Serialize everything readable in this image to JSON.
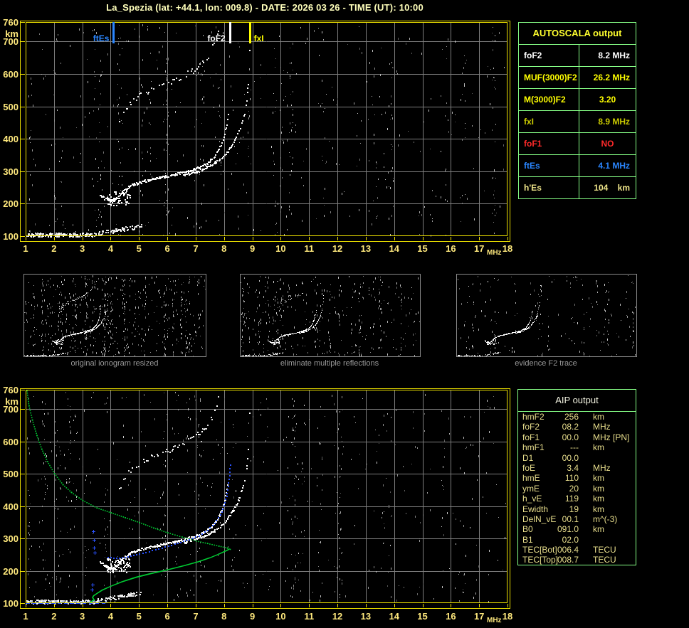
{
  "title": "La_Spezia (lat: +44.1, lon: 009.8) - DATE: 2026 03 26 - TIME (UT): 10:00",
  "colors": {
    "frame": "#eee200",
    "grid": "#7e7e7e",
    "tick_label": "#ffe97d",
    "table_border": "#86ff86",
    "profile_green": "#00cc33",
    "trace_blue": "#2a52ff",
    "echo_white": "#ffffff"
  },
  "autoscala": {
    "title": "AUTOSCALA output",
    "rows": [
      {
        "label": "foF2",
        "value": "8.2 MHz",
        "color": "#ffffff",
        "align": "r"
      },
      {
        "label": "MUF(3000)F2",
        "value": "26.2 MHz",
        "color": "#ffff00",
        "align": "r"
      },
      {
        "label": "M(3000)F2",
        "value": "3.20",
        "color": "#ffff00",
        "align": "c"
      },
      {
        "label": "fxI",
        "value": "8.9 MHz",
        "color": "#c9c900",
        "align": "r"
      },
      {
        "label": "foF1",
        "value": "NO",
        "color": "#ff2a2a",
        "align": "c"
      },
      {
        "label": "ftEs",
        "value": "4.1 MHz",
        "color": "#2a86ff",
        "align": "r"
      },
      {
        "label": "h'Es",
        "value": "104    km",
        "color": "#efe58a",
        "align": "r"
      }
    ]
  },
  "aip": {
    "title": "AIP output",
    "rows": [
      {
        "label": "hmF2",
        "value": "256",
        "unit": "km",
        "note": ""
      },
      {
        "label": "foF2",
        "value": "08.2",
        "unit": "MHz",
        "note": ""
      },
      {
        "label": "foF1",
        "value": "00.0",
        "unit": "MHz",
        "note": "[PN]"
      },
      {
        "label": "hmF1",
        "value": "---",
        "unit": "km",
        "note": ""
      },
      {
        "label": "D1",
        "value": "00.0",
        "unit": "",
        "note": ""
      },
      {
        "label": "foE",
        "value": "3.4",
        "unit": "MHz",
        "note": ""
      },
      {
        "label": "hmE",
        "value": "110",
        "unit": "km",
        "note": ""
      },
      {
        "label": "ymE",
        "value": "20",
        "unit": "km",
        "note": ""
      },
      {
        "label": "h_vE",
        "value": "119",
        "unit": "km",
        "note": ""
      },
      {
        "label": "Ewidth",
        "value": "19",
        "unit": "km",
        "note": ""
      },
      {
        "label": "DelN_vE",
        "value": "00.1",
        "unit": "m^(-3)",
        "note": ""
      },
      {
        "label": "B0",
        "value": "091.0",
        "unit": "km",
        "note": ""
      },
      {
        "label": "B1",
        "value": "02.0",
        "unit": "",
        "note": ""
      },
      {
        "label": "TEC[Bot]",
        "value": "006.4",
        "unit": "TECU",
        "note": ""
      },
      {
        "label": "TEC[Top]",
        "value": "008.7",
        "unit": "TECU",
        "note": ""
      }
    ]
  },
  "thumbnails": [
    {
      "caption": "original ionogram resized",
      "noise": 720,
      "hop": 1,
      "seed": 21
    },
    {
      "caption": "eliminate multiple reflections",
      "noise": 430,
      "hop": 0.35,
      "seed": 22
    },
    {
      "caption": "evidence F2 trace",
      "noise": 210,
      "hop": 0,
      "seed": 23
    }
  ],
  "chart_data": [
    {
      "type": "scatter",
      "title": "scaled ionogram",
      "xlabel": "MHz",
      "ylabel": "km",
      "xlim": [
        1,
        18
      ],
      "ylim": [
        100,
        760
      ],
      "xticks": [
        1,
        2,
        3,
        4,
        5,
        6,
        7,
        8,
        9,
        10,
        11,
        12,
        13,
        14,
        15,
        16,
        17,
        18
      ],
      "yticks": [
        760,
        700,
        600,
        500,
        400,
        300,
        200,
        100
      ],
      "grid": true,
      "markers": [
        {
          "label": "ftEs",
          "f": 4.1,
          "color": "#2a86ff"
        },
        {
          "label": "foF2",
          "f": 8.2,
          "color": "#ffffff"
        },
        {
          "label": "fxI",
          "f": 8.9,
          "color": "#ffff00"
        }
      ],
      "series": {
        "es_band": {
          "f_range": [
            1.0,
            5.1
          ],
          "h_range": [
            100,
            135
          ]
        },
        "f_blob": {
          "f_range": [
            3.85,
            4.7
          ],
          "h_range": [
            196,
            240
          ]
        },
        "o_trace": [
          [
            3.6,
            230
          ],
          [
            3.75,
            219
          ],
          [
            3.95,
            210
          ],
          [
            4.1,
            211
          ],
          [
            4.25,
            222
          ],
          [
            4.45,
            242
          ],
          [
            4.7,
            257
          ],
          [
            5.0,
            267
          ],
          [
            5.4,
            276
          ],
          [
            5.8,
            283
          ],
          [
            6.2,
            290
          ],
          [
            6.6,
            299
          ],
          [
            7.0,
            309
          ],
          [
            7.3,
            321
          ],
          [
            7.55,
            338
          ],
          [
            7.75,
            360
          ],
          [
            7.9,
            388
          ],
          [
            8.0,
            415
          ],
          [
            8.06,
            440
          ],
          [
            8.1,
            462
          ],
          [
            8.13,
            480
          ]
        ],
        "x_trace": [
          [
            6.55,
            288
          ],
          [
            6.9,
            297
          ],
          [
            7.25,
            308
          ],
          [
            7.55,
            320
          ],
          [
            7.85,
            338
          ],
          [
            8.05,
            356
          ],
          [
            8.25,
            380
          ],
          [
            8.4,
            403
          ],
          [
            8.55,
            432
          ],
          [
            8.65,
            460
          ],
          [
            8.73,
            492
          ],
          [
            8.79,
            528
          ],
          [
            8.83,
            566
          ],
          [
            8.86,
            610
          ],
          [
            8.88,
            655
          ],
          [
            8.89,
            700
          ],
          [
            8.895,
            735
          ]
        ],
        "second_hop": "2x o_trace, f 4.3-8.3"
      },
      "noise": {
        "seed": 7,
        "count": 680,
        "streaks": 32
      }
    },
    {
      "type": "scatter",
      "title": "ionogram with AIP fitted trace and electron density profile",
      "xlabel": "MHz",
      "ylabel": "km",
      "xlim": [
        1,
        18
      ],
      "ylim": [
        100,
        760
      ],
      "xticks": [
        1,
        2,
        3,
        4,
        5,
        6,
        7,
        8,
        9,
        10,
        11,
        12,
        13,
        14,
        15,
        16,
        17,
        18
      ],
      "yticks": [
        760,
        700,
        600,
        500,
        400,
        300,
        200,
        100
      ],
      "grid": true,
      "overlays": {
        "blue_es": [
          1.0,
          3.85,
          105
        ],
        "blue_trace": [
          [
            3.9,
            244
          ],
          [
            4.2,
            240
          ],
          [
            4.6,
            245
          ],
          [
            5.0,
            254
          ],
          [
            5.45,
            264
          ],
          [
            5.9,
            275
          ],
          [
            6.35,
            287
          ],
          [
            6.75,
            299
          ],
          [
            7.1,
            310
          ],
          [
            7.4,
            327
          ],
          [
            7.65,
            349
          ],
          [
            7.85,
            375
          ],
          [
            7.98,
            403
          ],
          [
            8.07,
            432
          ],
          [
            8.13,
            462
          ],
          [
            8.17,
            495
          ],
          [
            8.2,
            530
          ]
        ],
        "blue_cluster": [
          [
            3.38,
            322
          ],
          [
            3.4,
            295
          ],
          [
            3.42,
            272
          ],
          [
            3.44,
            256
          ],
          [
            3.35,
            158
          ],
          [
            3.33,
            142
          ]
        ],
        "green_bottomside": [
          [
            3.18,
            101
          ],
          [
            3.3,
            104
          ],
          [
            3.42,
            110
          ],
          [
            3.36,
            117
          ],
          [
            3.4,
            123
          ],
          [
            3.52,
            130
          ],
          [
            3.7,
            140
          ],
          [
            4.0,
            152
          ],
          [
            4.4,
            166
          ],
          [
            4.9,
            180
          ],
          [
            5.4,
            191
          ],
          [
            6.0,
            203
          ],
          [
            6.6,
            216
          ],
          [
            7.1,
            228
          ],
          [
            7.5,
            240
          ],
          [
            7.8,
            251
          ],
          [
            8.0,
            259
          ],
          [
            8.12,
            264
          ],
          [
            8.2,
            268
          ]
        ],
        "green_topside": [
          [
            8.2,
            268
          ],
          [
            8.1,
            272
          ],
          [
            7.8,
            278
          ],
          [
            7.4,
            286
          ],
          [
            7.0,
            294
          ],
          [
            6.5,
            306
          ],
          [
            6.0,
            319
          ],
          [
            5.5,
            334
          ],
          [
            5.0,
            351
          ],
          [
            4.5,
            366
          ],
          [
            4.0,
            381
          ],
          [
            3.5,
            396
          ],
          [
            3.0,
            419
          ],
          [
            2.6,
            444
          ],
          [
            2.3,
            468
          ],
          [
            2.0,
            502
          ],
          [
            1.75,
            540
          ],
          [
            1.55,
            578
          ],
          [
            1.38,
            620
          ],
          [
            1.22,
            668
          ],
          [
            1.1,
            712
          ],
          [
            1.03,
            758
          ]
        ]
      },
      "noise": {
        "seed": 13,
        "count": 720,
        "streaks": 32
      }
    }
  ]
}
